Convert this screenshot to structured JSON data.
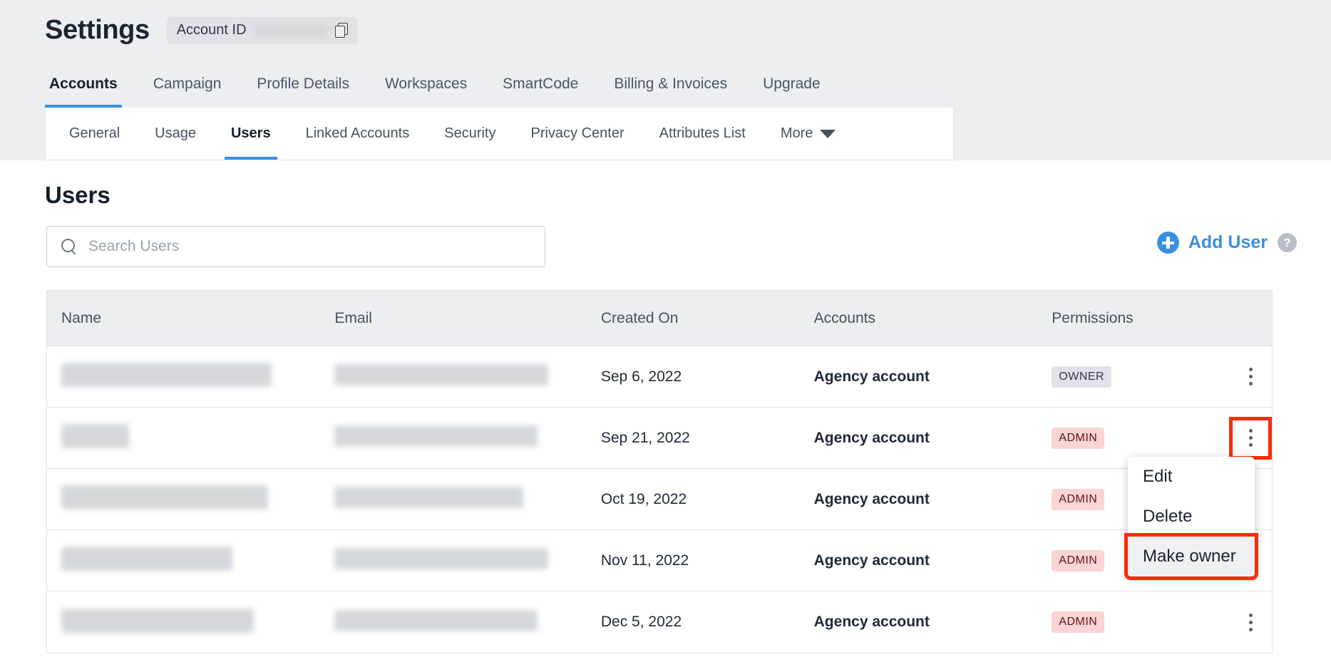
{
  "header": {
    "title": "Settings",
    "account_pill": {
      "label": "Account ID",
      "value_redacted": true,
      "copy_icon": "copy-icon"
    }
  },
  "primary_tabs": {
    "active": "Accounts",
    "items": [
      {
        "label": "Accounts"
      },
      {
        "label": "Campaign"
      },
      {
        "label": "Profile Details"
      },
      {
        "label": "Workspaces"
      },
      {
        "label": "SmartCode"
      },
      {
        "label": "Billing & Invoices"
      },
      {
        "label": "Upgrade"
      }
    ]
  },
  "secondary_tabs": {
    "active": "Users",
    "items": [
      {
        "label": "General"
      },
      {
        "label": "Usage"
      },
      {
        "label": "Users"
      },
      {
        "label": "Linked Accounts"
      },
      {
        "label": "Security"
      },
      {
        "label": "Privacy Center"
      },
      {
        "label": "Attributes List"
      },
      {
        "label": "More"
      }
    ]
  },
  "main": {
    "section_title": "Users",
    "search": {
      "placeholder": "Search Users",
      "value": ""
    },
    "add_user": {
      "label": "Add User",
      "icon": "plus-circle-icon"
    },
    "help": {
      "label": "?",
      "icon": "question-mark-icon"
    }
  },
  "table": {
    "columns": [
      "Name",
      "Email",
      "Created On",
      "Accounts",
      "Permissions"
    ],
    "rows": [
      {
        "name": "",
        "email": "",
        "created_on": "Sep 6, 2022",
        "accounts": "Agency account",
        "permission": "OWNER",
        "permission_type": "owner"
      },
      {
        "name": "",
        "email": "",
        "created_on": "Sep 21, 2022",
        "accounts": "Agency account",
        "permission": "ADMIN",
        "permission_type": "admin"
      },
      {
        "name": "",
        "email": "",
        "created_on": "Oct 19, 2022",
        "accounts": "Agency account",
        "permission": "ADMIN",
        "permission_type": "admin"
      },
      {
        "name": "",
        "email": "",
        "created_on": "Nov 11, 2022",
        "accounts": "Agency account",
        "permission": "ADMIN",
        "permission_type": "admin"
      },
      {
        "name": "",
        "email": "",
        "created_on": "Dec 5, 2022",
        "accounts": "Agency account",
        "permission": "ADMIN",
        "permission_type": "admin"
      }
    ]
  },
  "row_menu": {
    "items": [
      {
        "label": "Edit",
        "selected": false
      },
      {
        "label": "Delete",
        "selected": false
      },
      {
        "label": "Make owner",
        "selected": true
      }
    ]
  },
  "colors": {
    "accent_blue": "#3b8fe0",
    "highlight_red": "#f92d00",
    "badge_owner_bg": "#dfe3e8",
    "badge_admin_bg": "#fbd4d4",
    "page_bg": "#eceef1",
    "panel_bg": "#ffffff",
    "border": "#dfe3e8"
  }
}
